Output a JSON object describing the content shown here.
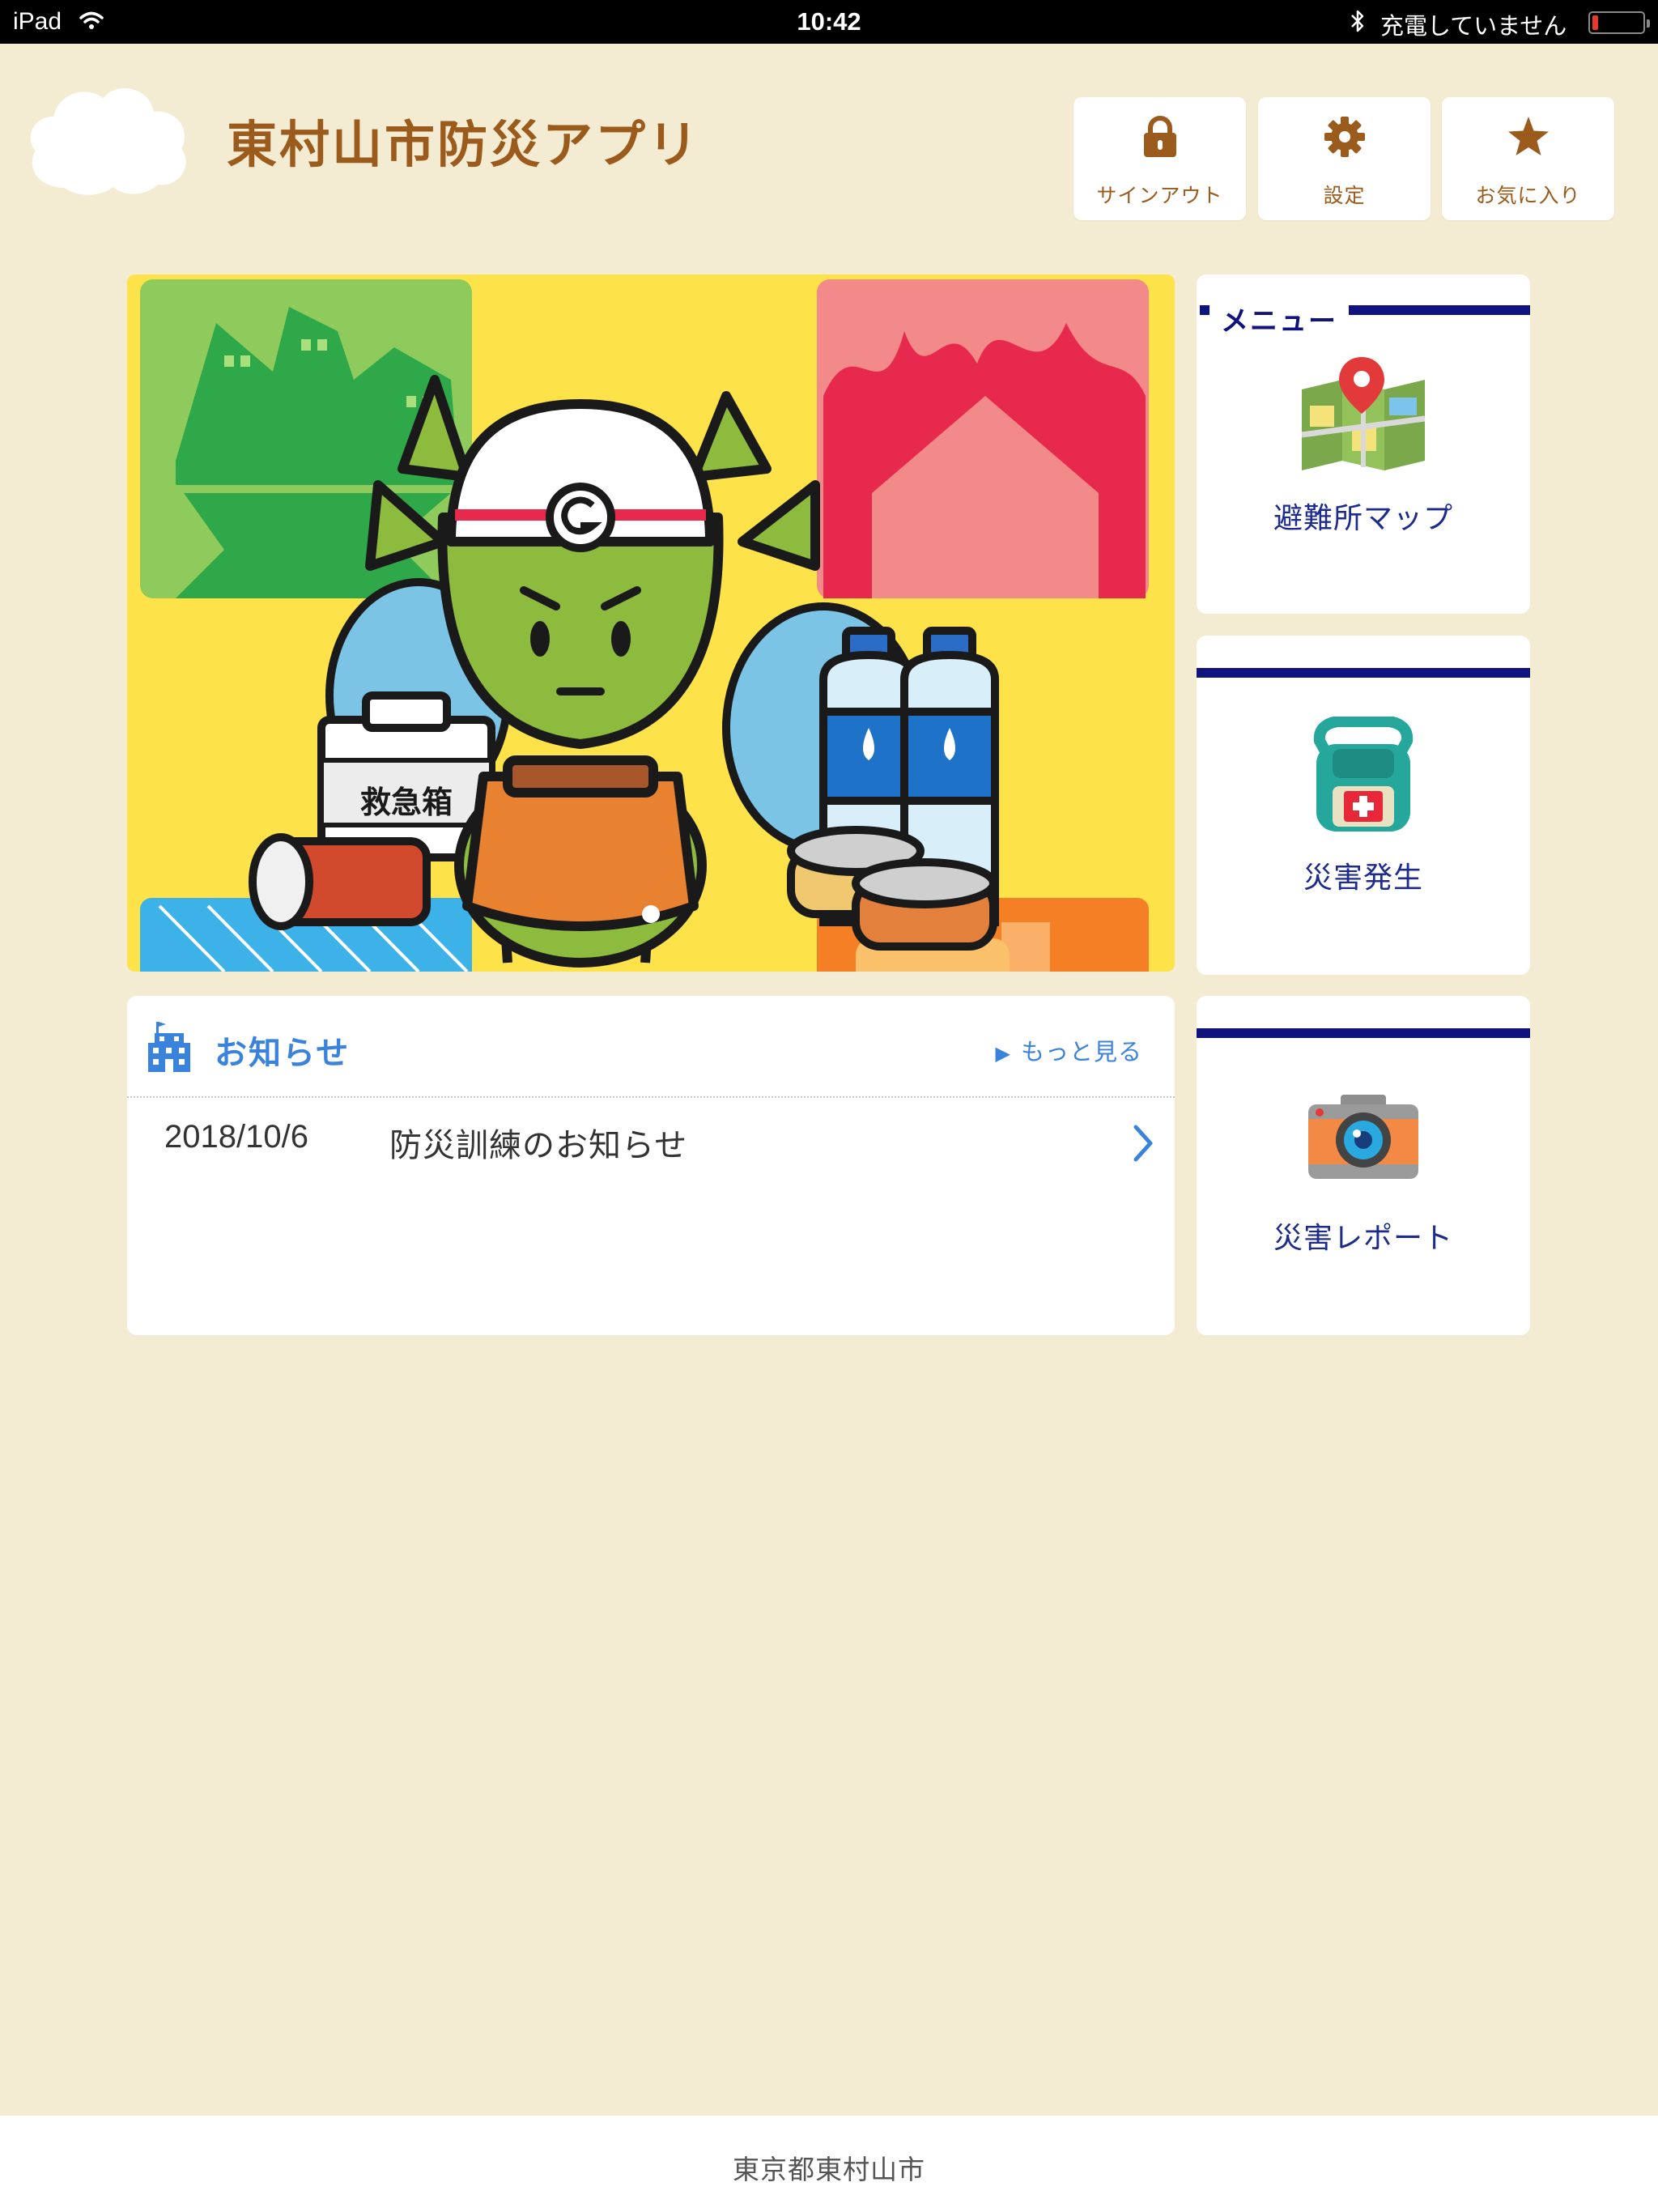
{
  "status_bar": {
    "device": "iPad",
    "time": "10:42",
    "charging_text": "充電していません"
  },
  "header": {
    "title": "東村山市防災アプリ",
    "buttons": {
      "signout": "サインアウト",
      "settings": "設定",
      "favorites": "お気に入り"
    },
    "accent": "#9a5b1c"
  },
  "banner": {
    "first_aid_label": "救急箱",
    "page_count": 1,
    "current_page": 1
  },
  "news": {
    "title": "お知らせ",
    "more_label": "もっと見る",
    "items": [
      {
        "date": "2018/10/6",
        "text": "防災訓練のお知らせ"
      }
    ],
    "accent": "#3a83dd"
  },
  "menu": {
    "heading": "メニュー",
    "items": [
      {
        "label": "避難所マップ",
        "icon": "map-pin-icon"
      },
      {
        "label": "災害発生",
        "icon": "emergency-backpack-icon"
      },
      {
        "label": "災害レポート",
        "icon": "camera-icon"
      }
    ],
    "bar_color": "#10137e"
  },
  "footer": {
    "text": "東京都東村山市"
  }
}
